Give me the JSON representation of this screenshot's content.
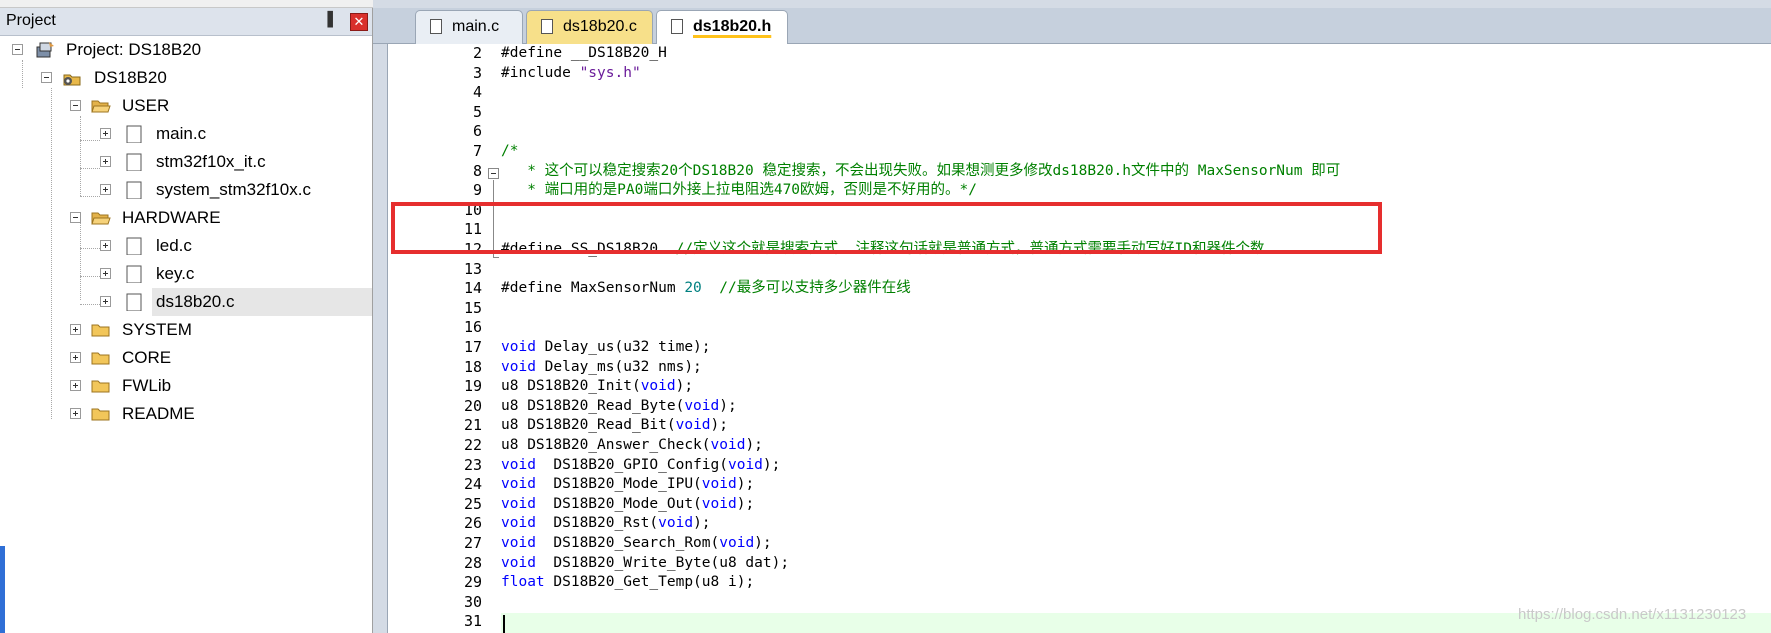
{
  "project_panel": {
    "title": "Project",
    "pin_glyph": "▐",
    "close_glyph": "✕",
    "tree": [
      {
        "label": "Project: DS18B20",
        "icon": "project-icon"
      },
      {
        "label": "DS18B20",
        "icon": "target-icon"
      },
      {
        "label": "USER",
        "icon": "folder-open-icon"
      },
      {
        "label": "main.c",
        "icon": "file-icon"
      },
      {
        "label": "stm32f10x_it.c",
        "icon": "file-icon"
      },
      {
        "label": "system_stm32f10x.c",
        "icon": "file-icon"
      },
      {
        "label": "HARDWARE",
        "icon": "folder-open-icon"
      },
      {
        "label": "led.c",
        "icon": "file-icon"
      },
      {
        "label": "key.c",
        "icon": "file-icon"
      },
      {
        "label": "ds18b20.c",
        "icon": "file-icon"
      },
      {
        "label": "SYSTEM",
        "icon": "folder-icon"
      },
      {
        "label": "CORE",
        "icon": "folder-icon"
      },
      {
        "label": "FWLib",
        "icon": "folder-icon"
      },
      {
        "label": "README",
        "icon": "folder-icon"
      }
    ]
  },
  "tabs": [
    {
      "label": "main.c"
    },
    {
      "label": "ds18b20.c"
    },
    {
      "label": "ds18b20.h",
      "active": true
    }
  ],
  "editor": {
    "line_numbers": [
      "2",
      "3",
      "4",
      "5",
      "6",
      "7",
      "8",
      "9",
      "10",
      "11",
      "12",
      "13",
      "14",
      "15",
      "16",
      "17",
      "18",
      "19",
      "20",
      "21",
      "22",
      "23",
      "24",
      "25",
      "26",
      "27",
      "28",
      "29",
      "30",
      "31"
    ],
    "lines": {
      "l2": "#define __DS18B20_H",
      "l3a": "#include ",
      "l3b": "\"sys.h\"",
      "l6": "/*",
      "l7": "   * 这个可以稳定搜索20个DS18B20 稳定搜索，不会出现失败。如果想测更多修改ds18B20.h文件中的 MaxSensorNum 即可",
      "l8": "   * 端口用的是PA0端口外接上拉电阻选470欧姆，否则是不好用的。*/",
      "l11a": "#define SS_DS18B20  ",
      "l11b": "//定义这个就是搜索方式  注释这句话就是普通方式，普通方式需要手动写好ID和器件个数",
      "l13a": "#define MaxSensorNum ",
      "l13b": "20",
      "l13c": "  //最多可以支持多少器件在线",
      "l16a": "void",
      "l16b": " Delay_us(u32 time);",
      "l17a": "void",
      "l17b": " Delay_ms(u32 nms);",
      "l18a": "u8 DS18B20_Init(",
      "l18b": "void",
      "l18c": ");",
      "l19a": "u8 DS18B20_Read_Byte(",
      "l19b": "void",
      "l19c": ");",
      "l20a": "u8 DS18B20_Read_Bit(",
      "l20b": "void",
      "l20c": ");",
      "l21a": "u8 DS18B20_Answer_Check(",
      "l21b": "void",
      "l21c": ");",
      "l22a": "void",
      "l22b": "  DS18B20_GPIO_Config(",
      "l22c": "void",
      "l22d": ");",
      "l23a": "void",
      "l23b": "  DS18B20_Mode_IPU(",
      "l23c": "void",
      "l23d": ");",
      "l24a": "void",
      "l24b": "  DS18B20_Mode_Out(",
      "l24c": "void",
      "l24d": ");",
      "l25a": "void",
      "l25b": "  DS18B20_Rst(",
      "l25c": "void",
      "l25d": ");",
      "l26a": "void",
      "l26b": "  DS18B20_Search_Rom(",
      "l26c": "void",
      "l26d": ");",
      "l27a": "void",
      "l27b": "  DS18B20_Write_Byte(u8 dat);",
      "l28a": "float",
      "l28b": " DS18B20_Get_Temp(u8 i);"
    }
  },
  "watermark": "https://blog.csdn.net/x1131230123",
  "colors": {
    "keyword": "#0000ff",
    "comment": "#008000",
    "string": "#6a1b9a",
    "number": "#008080",
    "highlight_box": "#e62e2e"
  }
}
